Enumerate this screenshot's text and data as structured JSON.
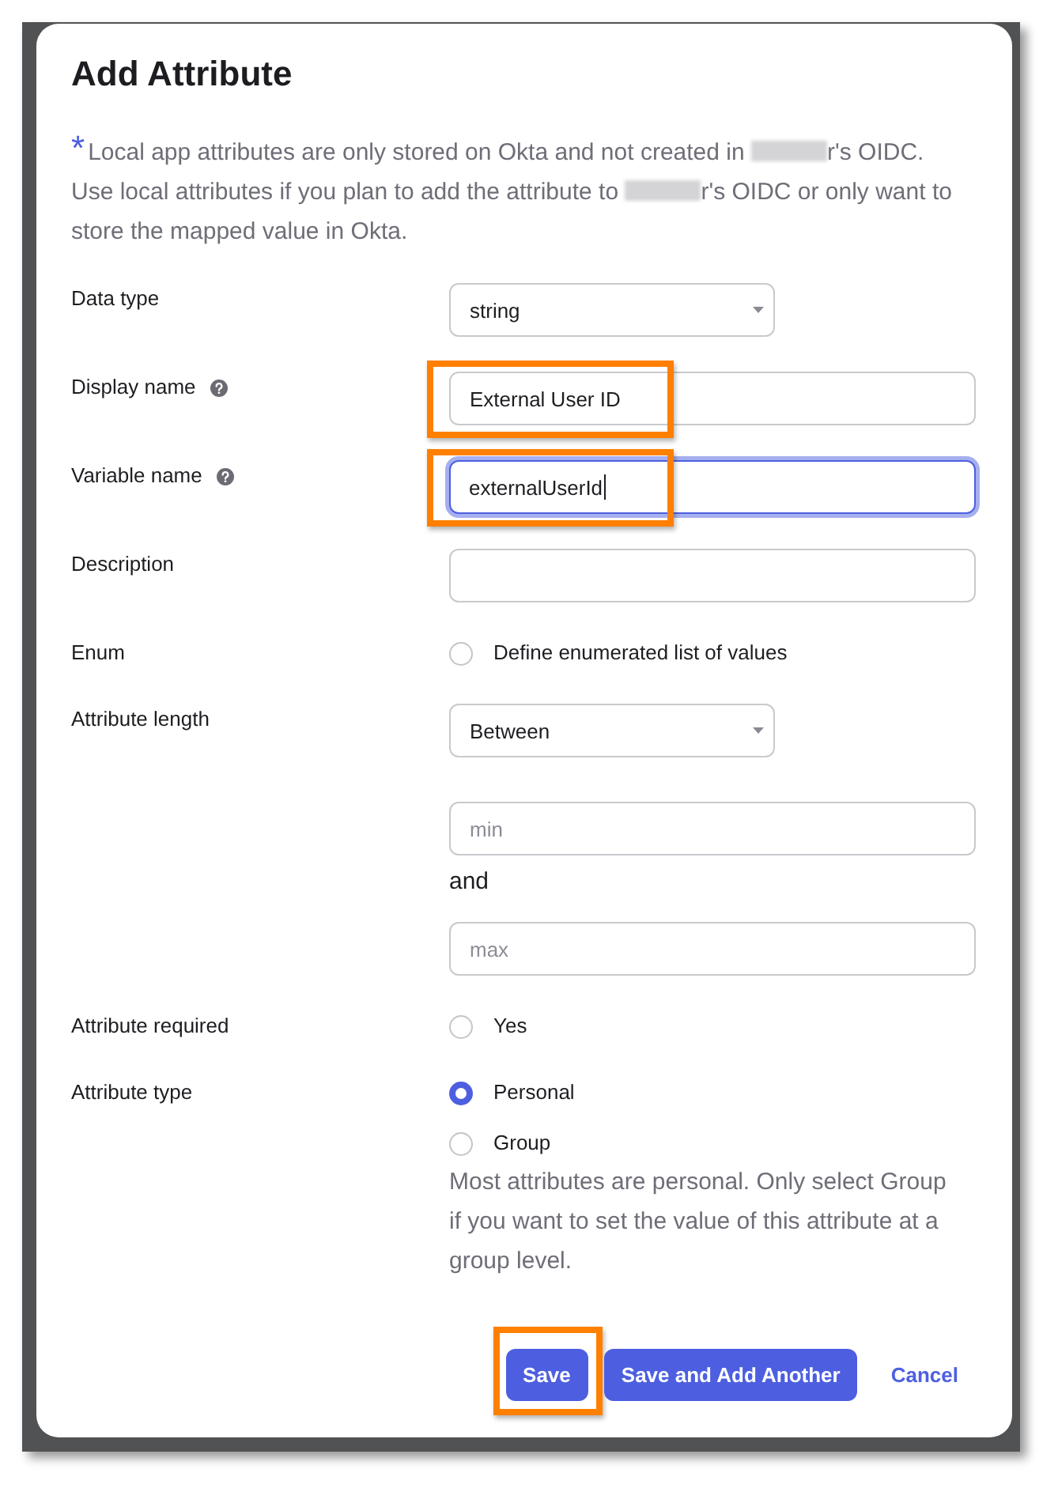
{
  "dialog": {
    "title": "Add Attribute",
    "note": {
      "marker": "*",
      "parts": [
        {
          "kind": "text",
          "text": "Local app attributes are only stored on Okta and not created in "
        },
        {
          "kind": "redacted"
        },
        {
          "kind": "text",
          "text": "r's OIDC. Use local attributes if you plan to add the attribute to "
        },
        {
          "kind": "redacted"
        },
        {
          "kind": "text",
          "text": "r's OIDC or only want to store the mapped value in Okta."
        }
      ]
    },
    "fields": [
      {
        "kind": "select",
        "label": "Data type",
        "help": false,
        "highlighted": false,
        "focused": false,
        "value": "string"
      },
      {
        "kind": "input",
        "label": "Display name",
        "help": true,
        "highlighted": true,
        "focused": false,
        "value": "External User ID"
      },
      {
        "kind": "input",
        "label": "Variable name",
        "help": true,
        "highlighted": true,
        "focused": true,
        "value": "externalUserId"
      },
      {
        "kind": "input",
        "label": "Description",
        "help": false,
        "highlighted": false,
        "focused": false
      },
      {
        "kind": "radios",
        "label": "Enum",
        "help": false,
        "highlighted": false,
        "options": [
          {
            "label": "Define enumerated list of values",
            "selected": false
          }
        ]
      },
      {
        "kind": "range",
        "label": "Attribute length",
        "help": false,
        "highlighted": false,
        "value": "Between",
        "min_placeholder": "min",
        "joiner": "and",
        "max_placeholder": "max"
      },
      {
        "kind": "radios",
        "label": "Attribute required",
        "help": false,
        "highlighted": false,
        "options": [
          {
            "label": "Yes",
            "selected": false
          }
        ]
      },
      {
        "kind": "radios",
        "label": "Attribute type",
        "help": false,
        "highlighted": false,
        "options": [
          {
            "label": "Personal",
            "selected": true
          },
          {
            "label": "Group",
            "selected": false
          }
        ],
        "hint": "Most attributes are personal. Only select Group if you want to set the value of this attribute at a group level."
      }
    ],
    "buttons": [
      {
        "kind": "primary",
        "label": "Save",
        "highlighted": true
      },
      {
        "kind": "primary",
        "label": "Save and Add Another",
        "highlighted": false
      },
      {
        "kind": "link",
        "label": "Cancel",
        "highlighted": false
      }
    ]
  }
}
